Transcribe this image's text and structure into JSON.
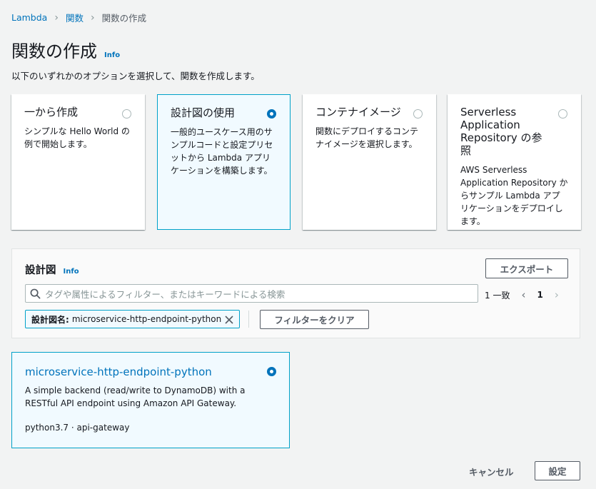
{
  "breadcrumbs": [
    "Lambda",
    "関数",
    "関数の作成"
  ],
  "page": {
    "title": "関数の作成",
    "info": "Info",
    "subtitle": "以下のいずれかのオプションを選択して、関数を作成します。"
  },
  "options": [
    {
      "title": "一から作成",
      "desc": "シンプルな Hello World の例で開始します。",
      "selected": false
    },
    {
      "title": "設計図の使用",
      "desc": "一般的ユースケース用のサンプルコードと設定プリセットから Lambda アプリケーションを構築します。",
      "selected": true
    },
    {
      "title": "コンテナイメージ",
      "desc": "関数にデプロイするコンテナイメージを選択します。",
      "selected": false
    },
    {
      "title": "Serverless Application Repository の参照",
      "desc": "AWS Serverless Application Repository からサンプル Lambda アプリケーションをデプロイします。",
      "selected": false
    }
  ],
  "blueprints": {
    "title": "設計図",
    "info": "Info",
    "export_label": "エクスポート",
    "search_placeholder": "タグや属性によるフィルター、またはキーワードによる検索",
    "match_count": "1 一致",
    "page_number": "1",
    "filter_token": {
      "key": "設計図名:",
      "value": "microservice-http-endpoint-python"
    },
    "clear_filter_label": "フィルターをクリア"
  },
  "blueprint_card": {
    "title": "microservice-http-endpoint-python",
    "desc": "A simple backend (read/write to DynamoDB) with a RESTful API endpoint using Amazon API Gateway.",
    "meta": "python3.7 · api-gateway",
    "selected": true
  },
  "footer": {
    "cancel_label": "キャンセル",
    "configure_label": "設定"
  },
  "colors": {
    "accent": "#0073bb",
    "selected_border": "#00a1c9",
    "selected_bg": "#f1faff"
  }
}
